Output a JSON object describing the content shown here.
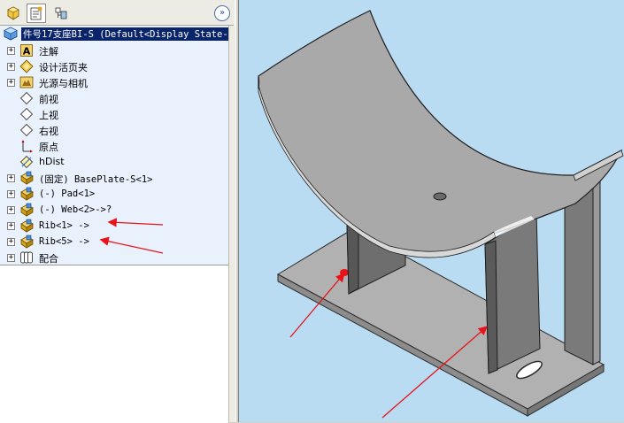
{
  "feature_tree": {
    "root_label": "件号17支座BI-S  (Default<Display State-",
    "items": [
      {
        "label": "注解",
        "icon": "annotations-icon",
        "expandable": true
      },
      {
        "label": "设计活页夹",
        "icon": "design-binder-icon",
        "expandable": true
      },
      {
        "label": "光源与相机",
        "icon": "lights-cameras-icon",
        "expandable": true
      },
      {
        "label": "前视",
        "icon": "plane-icon",
        "expandable": false
      },
      {
        "label": "上视",
        "icon": "plane-icon",
        "expandable": false
      },
      {
        "label": "右视",
        "icon": "plane-icon",
        "expandable": false
      },
      {
        "label": "原点",
        "icon": "origin-icon",
        "expandable": false
      },
      {
        "label": "hDist",
        "icon": "sketch-icon",
        "expandable": false
      },
      {
        "label": "(固定) BasePlate-S<1>",
        "icon": "part-icon",
        "expandable": true
      },
      {
        "label": "(-) Pad<1>",
        "icon": "part-icon",
        "expandable": true
      },
      {
        "label": "(-) Web<2>->?",
        "icon": "part-icon",
        "expandable": true
      },
      {
        "label": "Rib<1> ->",
        "icon": "part-icon",
        "expandable": true
      },
      {
        "label": "Rib<5> ->",
        "icon": "part-icon",
        "expandable": true
      },
      {
        "label": "配合",
        "icon": "mates-icon",
        "expandable": true
      }
    ]
  },
  "colors": {
    "tree_background": "#e8f1fc",
    "viewport_background": "#badcf3",
    "selection": "#0a246a",
    "annotation_arrow": "#e8141a",
    "model_fill": "#a9a9a9"
  }
}
